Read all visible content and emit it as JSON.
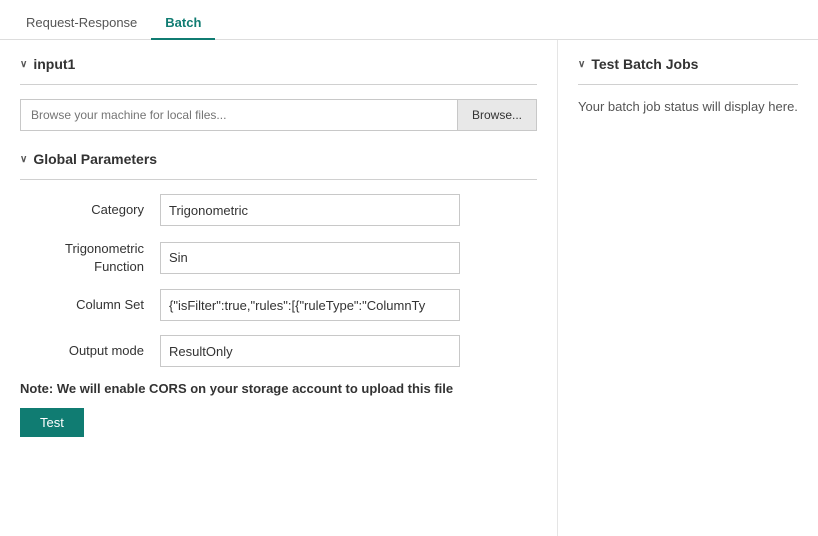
{
  "tabs": [
    {
      "id": "request-response",
      "label": "Request-Response",
      "active": false
    },
    {
      "id": "batch",
      "label": "Batch",
      "active": true
    }
  ],
  "left": {
    "input_section": {
      "title": "input1",
      "file_placeholder": "Browse your machine for local files...",
      "browse_button": "Browse..."
    },
    "global_params_section": {
      "title": "Global Parameters",
      "params": [
        {
          "label": "Category",
          "value": "Trigonometric"
        },
        {
          "label": "Trigonometric\nFunction",
          "value": "Sin"
        },
        {
          "label": "Column Set",
          "value": "{\"isFilter\":true,\"rules\":[{\"ruleType\":\"ColumnTy"
        },
        {
          "label": "Output mode",
          "value": "ResultOnly"
        }
      ]
    },
    "note": "Note: We will enable CORS on your storage account to upload this file",
    "test_button": "Test"
  },
  "right": {
    "title": "Test Batch Jobs",
    "status_text": "Your batch job status will display here."
  },
  "chevron_symbol": "∨"
}
